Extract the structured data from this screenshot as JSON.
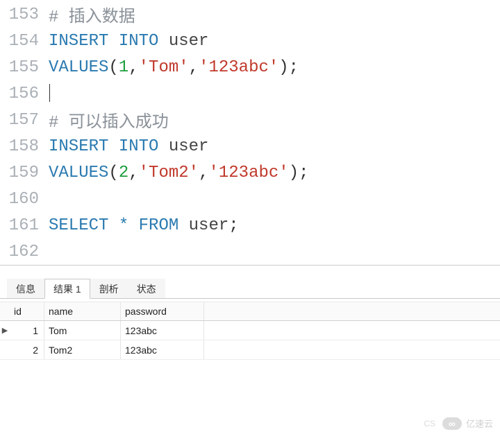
{
  "editor": {
    "lines": [
      {
        "no": "153",
        "tokens": [
          {
            "cls": "comment",
            "t": "# 插入数据"
          }
        ]
      },
      {
        "no": "154",
        "tokens": [
          {
            "cls": "kw",
            "t": "INSERT"
          },
          {
            "cls": "punct",
            "t": " "
          },
          {
            "cls": "kw",
            "t": "INTO"
          },
          {
            "cls": "punct",
            "t": " "
          },
          {
            "cls": "ident",
            "t": "user"
          }
        ]
      },
      {
        "no": "155",
        "tokens": [
          {
            "cls": "kw",
            "t": "VALUES"
          },
          {
            "cls": "punct",
            "t": "("
          },
          {
            "cls": "num",
            "t": "1"
          },
          {
            "cls": "punct",
            "t": ","
          },
          {
            "cls": "str",
            "t": "'Tom'"
          },
          {
            "cls": "punct",
            "t": ","
          },
          {
            "cls": "str",
            "t": "'123abc'"
          },
          {
            "cls": "punct",
            "t": ");"
          }
        ]
      },
      {
        "no": "156",
        "tokens": [],
        "caret": true
      },
      {
        "no": "157",
        "tokens": [
          {
            "cls": "comment",
            "t": "# 可以插入成功"
          }
        ]
      },
      {
        "no": "158",
        "tokens": [
          {
            "cls": "kw",
            "t": "INSERT"
          },
          {
            "cls": "punct",
            "t": " "
          },
          {
            "cls": "kw",
            "t": "INTO"
          },
          {
            "cls": "punct",
            "t": " "
          },
          {
            "cls": "ident",
            "t": "user"
          }
        ]
      },
      {
        "no": "159",
        "tokens": [
          {
            "cls": "kw",
            "t": "VALUES"
          },
          {
            "cls": "punct",
            "t": "("
          },
          {
            "cls": "num",
            "t": "2"
          },
          {
            "cls": "punct",
            "t": ","
          },
          {
            "cls": "str",
            "t": "'Tom2'"
          },
          {
            "cls": "punct",
            "t": ","
          },
          {
            "cls": "str",
            "t": "'123abc'"
          },
          {
            "cls": "punct",
            "t": ");"
          }
        ]
      },
      {
        "no": "160",
        "tokens": []
      },
      {
        "no": "161",
        "tokens": [
          {
            "cls": "kw",
            "t": "SELECT"
          },
          {
            "cls": "punct",
            "t": " "
          },
          {
            "cls": "star",
            "t": "*"
          },
          {
            "cls": "punct",
            "t": " "
          },
          {
            "cls": "kw",
            "t": "FROM"
          },
          {
            "cls": "punct",
            "t": " "
          },
          {
            "cls": "ident",
            "t": "user"
          },
          {
            "cls": "punct",
            "t": ";"
          }
        ]
      },
      {
        "no": "162",
        "tokens": []
      }
    ]
  },
  "tabs": {
    "items": [
      {
        "label": "信息",
        "active": false
      },
      {
        "label": "结果 1",
        "active": true
      },
      {
        "label": "剖析",
        "active": false
      },
      {
        "label": "状态",
        "active": false
      }
    ]
  },
  "result": {
    "columns": [
      "id",
      "name",
      "password"
    ],
    "rows": [
      {
        "marker": "▶",
        "id": "1",
        "name": "Tom",
        "password": "123abc"
      },
      {
        "marker": "",
        "id": "2",
        "name": "Tom2",
        "password": "123abc"
      }
    ]
  },
  "watermark": {
    "left": "CS",
    "brand": "亿速云"
  }
}
